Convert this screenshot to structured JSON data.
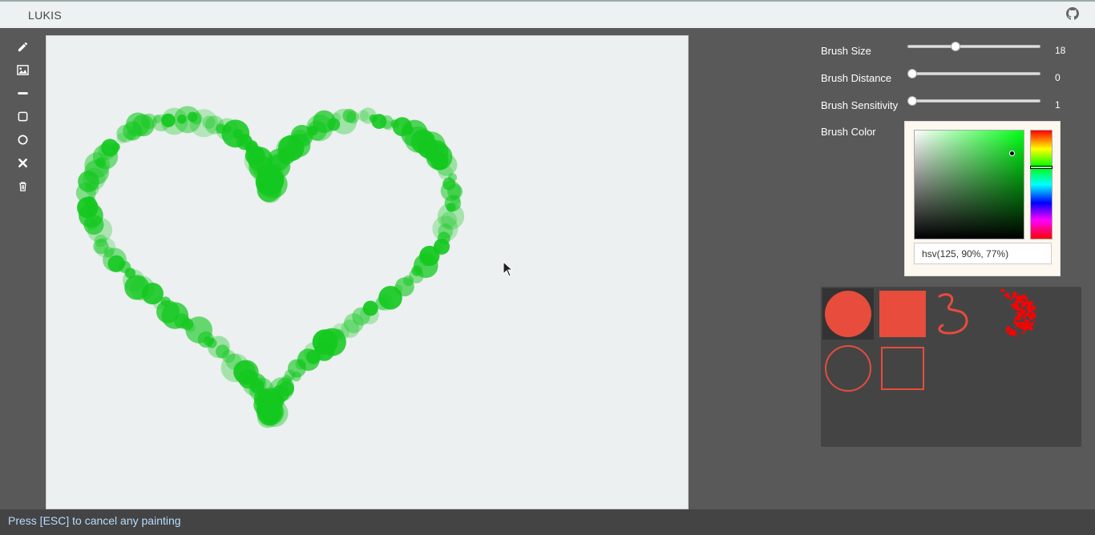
{
  "app": {
    "title": "LUKIS"
  },
  "header": {
    "github_icon": "github-icon"
  },
  "toolbar": {
    "tools": [
      {
        "name": "pencil-icon"
      },
      {
        "name": "image-icon"
      },
      {
        "name": "line-icon"
      },
      {
        "name": "rectangle-icon"
      },
      {
        "name": "circle-icon"
      },
      {
        "name": "close-icon"
      },
      {
        "name": "trash-icon"
      }
    ]
  },
  "settings": {
    "brush_size": {
      "label": "Brush Size",
      "value": "18"
    },
    "brush_distance": {
      "label": "Brush Distance",
      "value": "0"
    },
    "brush_sensitivity": {
      "label": "Brush Sensitivity",
      "value": "1"
    },
    "brush_color": {
      "label": "Brush Color",
      "value": "hsv(125, 90%, 77%)"
    }
  },
  "brushes": [
    {
      "name": "filled-circle",
      "selected": true
    },
    {
      "name": "filled-square",
      "selected": false
    },
    {
      "name": "freehand-line",
      "selected": false
    },
    {
      "name": "spray",
      "selected": false
    },
    {
      "name": "outline-circle",
      "selected": false
    },
    {
      "name": "outline-square",
      "selected": false
    }
  ],
  "colors": {
    "brush": "#14c81f",
    "accent": "#e74c3c",
    "status_text": "#b8dcff"
  },
  "status": {
    "text": "Press [ESC] to cancel any painting"
  }
}
